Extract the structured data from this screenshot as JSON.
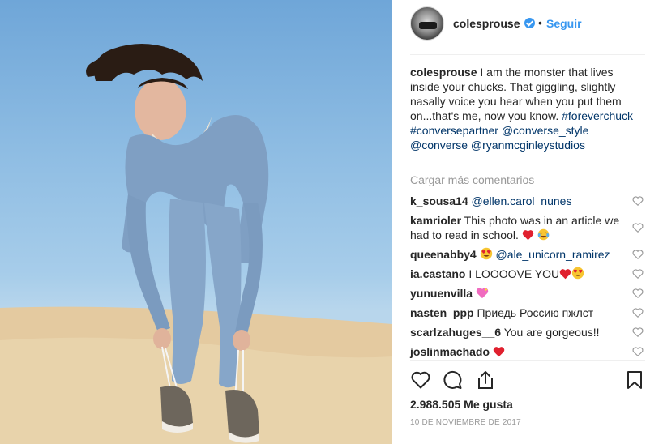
{
  "post": {
    "username": "colesprouse",
    "follow_label": "Seguir",
    "separator": "•"
  },
  "caption": {
    "username": "colesprouse",
    "text": " I am the monster that lives inside your chucks. That giggling, slightly nasally voice you hear when you put them on...that's me, now you know. ",
    "tag1": "#foreverchuck",
    "tag2": "#conversepartner",
    "mention1": "@converse_style",
    "mention2": "@converse",
    "mention3": "@ryanmcginleystudios"
  },
  "load_more": "Cargar más comentarios",
  "comments": [
    {
      "user": "k_sousa14",
      "text": "",
      "mention": "@ellen.carol_nunes"
    },
    {
      "user": "kamrioler",
      "text": " This photo was in an article we had to read in school. ",
      "mention": ""
    },
    {
      "user": "queenabby4",
      "text": " ",
      "mention": "@ale_unicorn_ramirez"
    },
    {
      "user": "ia.castano",
      "text": " I LOOOOVE YOU",
      "mention": ""
    },
    {
      "user": "yunuenvilla",
      "text": " ",
      "mention": ""
    },
    {
      "user": "nasten_ppp",
      "text": " Приедь Россию пжлст",
      "mention": ""
    },
    {
      "user": "scarlzahuges__6",
      "text": " You are gorgeous!!",
      "mention": ""
    },
    {
      "user": "joslinmachado",
      "text": " ",
      "mention": ""
    }
  ],
  "likes_text": "2.988.505 Me gusta",
  "date_text": "10 DE NOVIEMBRE DE 2017",
  "colors": {
    "link": "#003569",
    "accent": "#3897f0",
    "muted": "#999999"
  },
  "icons": [
    "verified-badge-icon",
    "heart-icon",
    "comment-icon",
    "share-icon",
    "bookmark-icon"
  ]
}
